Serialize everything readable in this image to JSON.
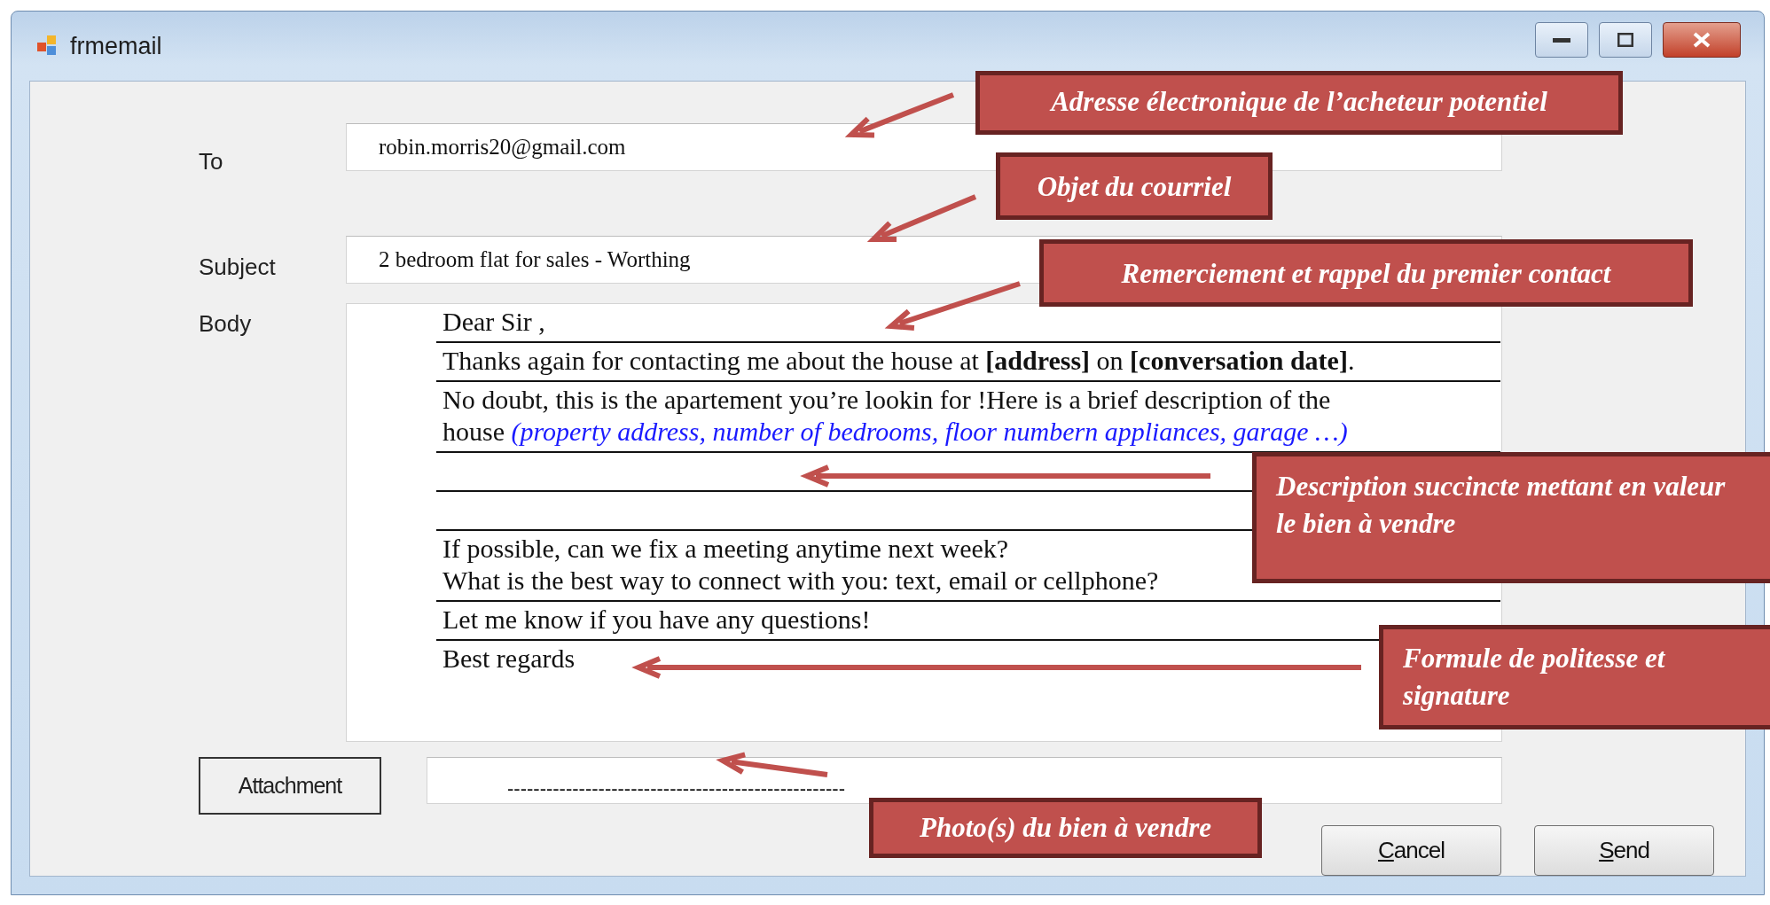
{
  "window": {
    "title": "frmemail"
  },
  "fields": [
    {
      "label": "To",
      "value": "robin.morris20@gmail.com"
    },
    {
      "label": "Subject",
      "value": "2 bedroom flat for sales - Worthing"
    }
  ],
  "body": {
    "label": "Body",
    "rows": [
      {
        "kind": "text",
        "lines": [
          "Dear Sir ,"
        ]
      },
      {
        "kind": "text",
        "lines": [
          "Thanks again for contacting me about the house at **[address]** on **[conversation date]**."
        ]
      },
      {
        "kind": "text",
        "lines": [
          "No doubt, this is the apartement you’re lookin for !Here is a brief description of the house *(property address, number of bedrooms, floor numbern appliances, garage …)*"
        ]
      },
      {
        "kind": "blank"
      },
      {
        "kind": "blank"
      },
      {
        "kind": "text",
        "lines": [
          "If possible, can we fix a meeting anytime next week?",
          "What is the best way to connect with you: text, email or cellphone?"
        ]
      },
      {
        "kind": "text",
        "lines": [
          "Let me know if you have any questions!"
        ]
      },
      {
        "kind": "text",
        "lines": [
          "Best regards"
        ]
      }
    ]
  },
  "attachment": {
    "button": "Attachment",
    "value": "----------------------------------------------------"
  },
  "buttons": [
    {
      "label": "Cancel"
    },
    {
      "label": "Send"
    }
  ],
  "annotations": [
    {
      "text": "Adresse électronique de l’acheteur potentiel"
    },
    {
      "text": "Objet du courriel"
    },
    {
      "text": "Remerciement et rappel du premier contact"
    },
    {
      "text": "Description succincte mettant en valeur le bien à vendre"
    },
    {
      "text": "Formule de politesse et signature"
    },
    {
      "text": "Photo(s) du bien à vendre"
    }
  ]
}
